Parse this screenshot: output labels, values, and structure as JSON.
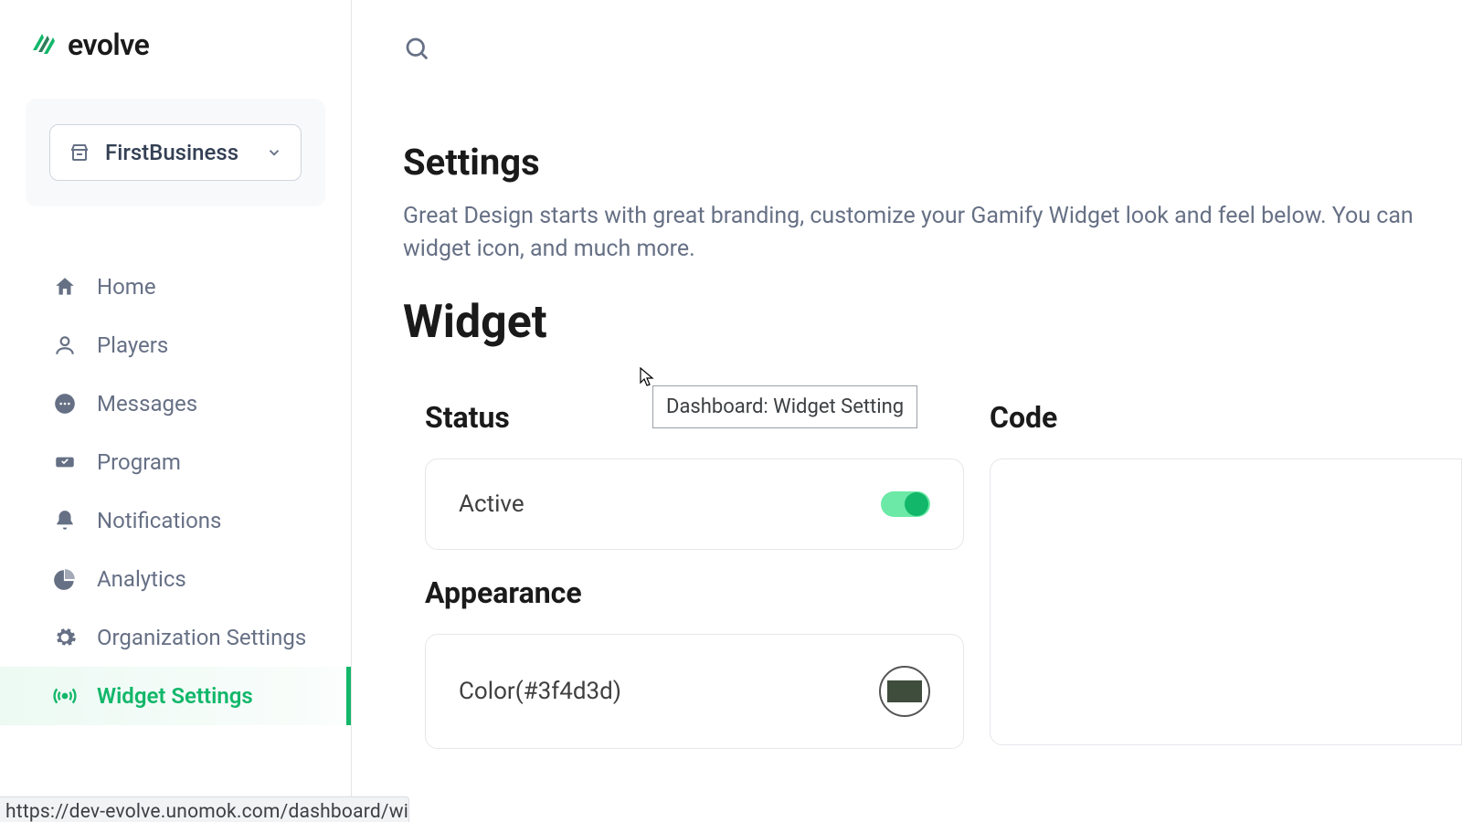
{
  "brand": {
    "name": "evolve"
  },
  "org": {
    "selected": "FirstBusiness"
  },
  "nav": {
    "items": [
      {
        "label": "Home"
      },
      {
        "label": "Players"
      },
      {
        "label": "Messages"
      },
      {
        "label": "Program"
      },
      {
        "label": "Notifications"
      },
      {
        "label": "Analytics"
      },
      {
        "label": "Organization Settings"
      },
      {
        "label": "Widget Settings"
      }
    ]
  },
  "page": {
    "title": "Settings",
    "description": "Great Design starts with great branding, customize your Gamify Widget look and feel below. You can widget icon, and much more.",
    "section": "Widget"
  },
  "status": {
    "heading": "Status",
    "active_label": "Active",
    "active": true
  },
  "appearance": {
    "heading": "Appearance",
    "color_label": "Color(#3f4d3d)",
    "color_value": "#3f4d3d"
  },
  "code": {
    "heading": "Code"
  },
  "tooltip": {
    "text": "Dashboard: Widget Setting"
  },
  "status_bar": {
    "url": "https://dev-evolve.unomok.com/dashboard/widget-settings"
  }
}
